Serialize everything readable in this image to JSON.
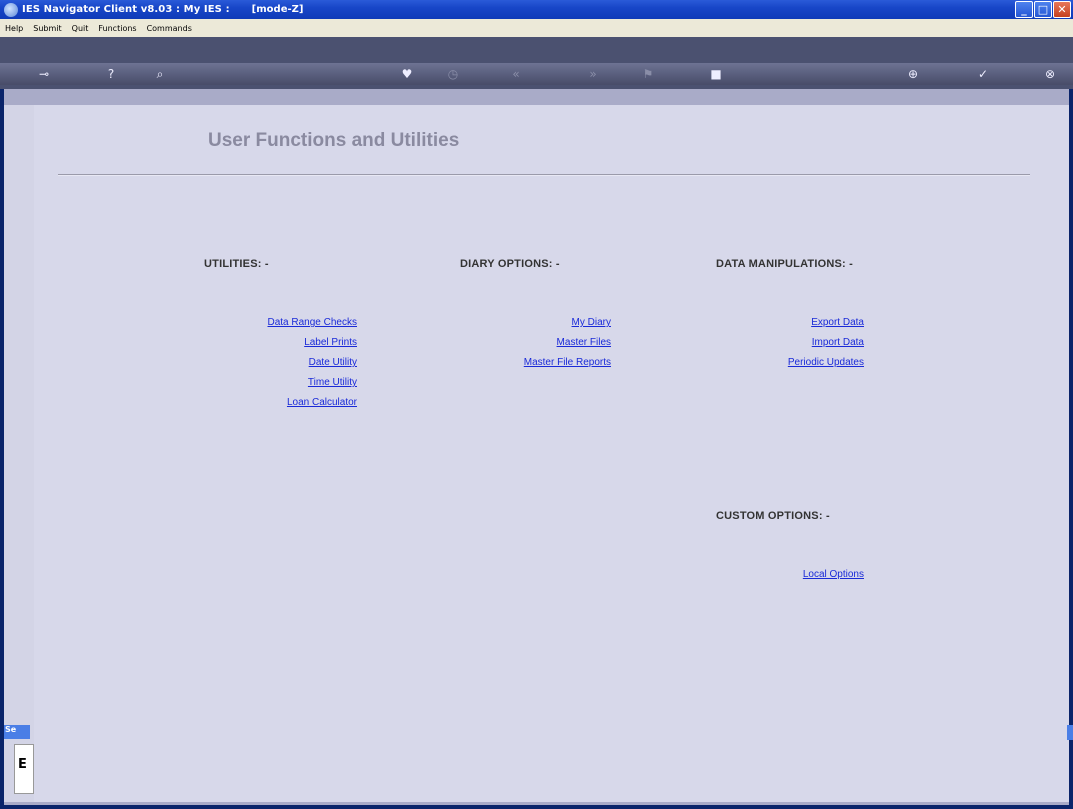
{
  "window": {
    "title": "IES Navigator Client v8.03 : My IES :",
    "mode": "[mode-Z]",
    "buttons": [
      "minimize",
      "maximize",
      "close"
    ]
  },
  "menubar": {
    "items": [
      "Help",
      "Submit",
      "Quit",
      "Functions",
      "Commands"
    ]
  },
  "toolbar": {
    "icons": [
      "key-icon",
      "help-icon",
      "search-icon",
      "heart-icon",
      "clock-icon",
      "back-icon",
      "forward-icon",
      "flag-icon",
      "stop-icon",
      "add-icon",
      "ok-icon",
      "close-icon"
    ]
  },
  "left_tab": {
    "label": "Se",
    "box_char": "E"
  },
  "main": {
    "title": "User Functions and Utilities",
    "utilities": {
      "heading": "UTILITIES: -",
      "links": [
        "Data Range Checks",
        "Label Prints",
        "Date Utility",
        "Time Utility",
        "Loan Calculator"
      ]
    },
    "diary": {
      "heading": "DIARY OPTIONS: -",
      "links": [
        "My Diary",
        "Master Files",
        "Master File Reports"
      ]
    },
    "data": {
      "heading": "DATA MANIPULATIONS: -",
      "links": [
        "Export Data",
        "Import Data",
        "Periodic Updates"
      ]
    },
    "custom": {
      "heading": "CUSTOM OPTIONS: -",
      "links": [
        "Local Options"
      ]
    }
  }
}
